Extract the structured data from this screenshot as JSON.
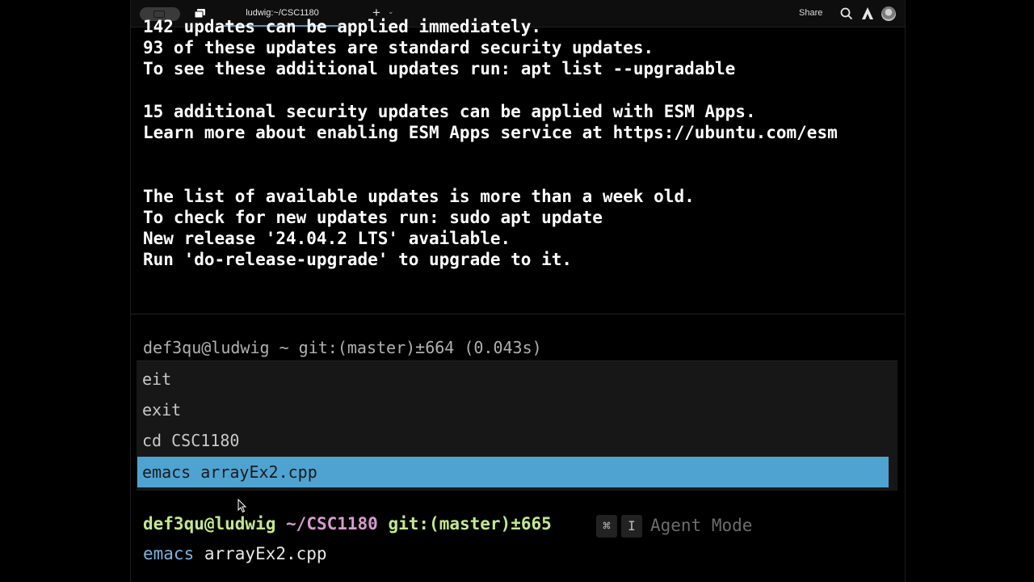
{
  "window": {
    "tab_title": "ludwig:~/CSC1180",
    "new_tab": "+",
    "tab_menu": "⌄",
    "share_label": "Share"
  },
  "output": {
    "lines": [
      "142 updates can be applied immediately.",
      "93 of these updates are standard security updates.",
      "To see these additional updates run: apt list --upgradable",
      "",
      "15 additional security updates can be applied with ESM Apps.",
      "Learn more about enabling ESM Apps service at https://ubuntu.com/esm",
      "",
      "",
      "The list of available updates is more than a week old.",
      "To check for new updates run: sudo apt update",
      "New release '24.04.2 LTS' available.",
      "Run 'do-release-upgrade' to upgrade to it."
    ]
  },
  "prev_prompt": "def3qu@ludwig ~ git:(master)±664 (0.043s)",
  "history": {
    "items": [
      "eit",
      "exit",
      "cd CSC1180",
      "emacs arrayEx2.cpp"
    ],
    "selected_index": 3
  },
  "prompt": {
    "user": "def3qu@ludwig",
    "dir": "~/CSC1180",
    "git": "git:(master)",
    "count": "±665",
    "kbd_cmd": "⌘",
    "kbd_key": "I",
    "agent_mode": "Agent Mode"
  },
  "input": {
    "command": "emacs",
    "args": " arrayEx2.cpp"
  },
  "colors": {
    "selection": "#4fa3d1",
    "prompt_green": "#c3e88d",
    "prompt_pink": "#d99ad0"
  }
}
